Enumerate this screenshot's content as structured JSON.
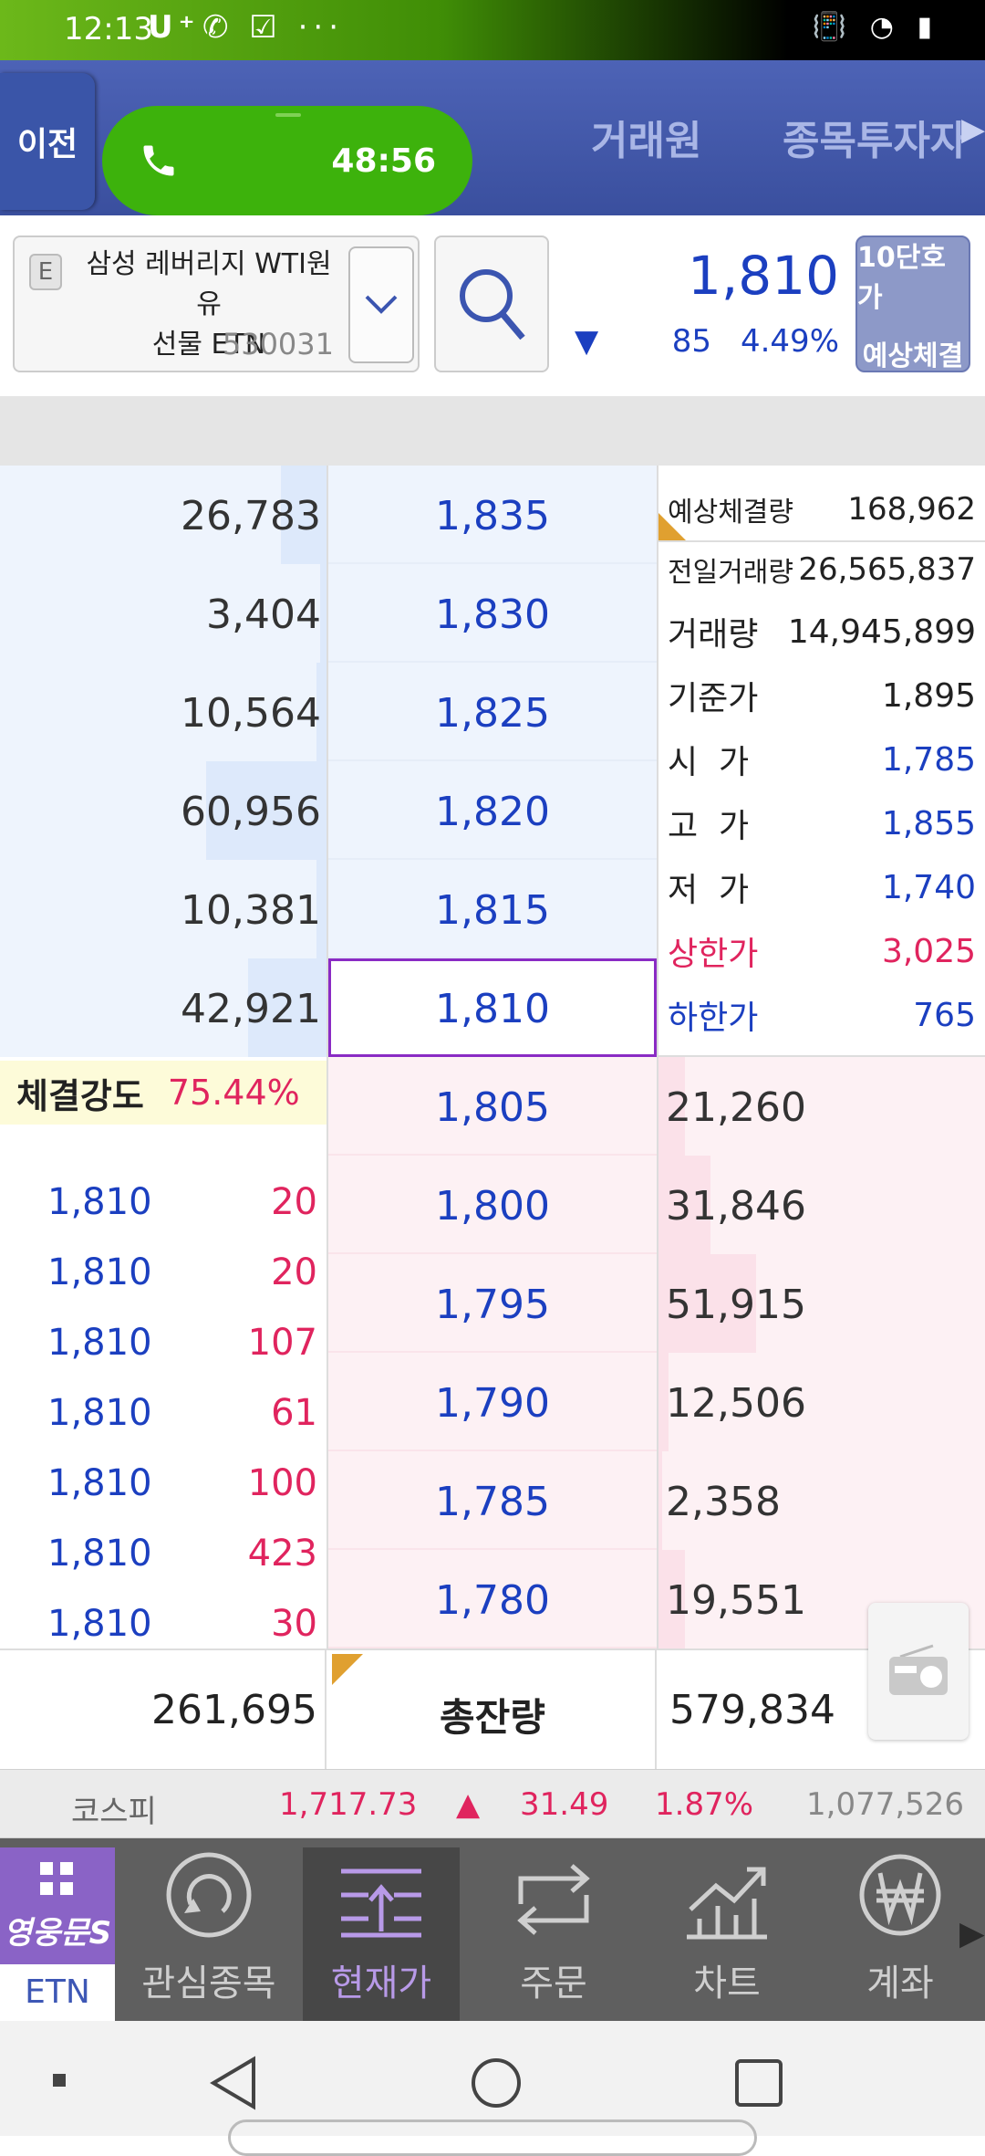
{
  "status": {
    "time": "12:13",
    "carrier": "U⁺",
    "left_icons": "✆ ☑ ···",
    "right_icons": "📳 ◔ ▮"
  },
  "header": {
    "back": "이전",
    "tabs": [
      "거래원",
      "종목투자자"
    ],
    "call_timer": "48:56",
    "tab_more": "▶"
  },
  "stock": {
    "badge": "E",
    "name_line1": "삼성 레버리지 WTI원유",
    "name_line2": "선물 ETN",
    "code": "530031",
    "price": "1,810",
    "direction": "▼",
    "change": "85",
    "change_pct": "4.49%",
    "hoga_btn_top": "10단호가",
    "hoga_btn_bottom": "예상체결"
  },
  "asks": [
    {
      "vol": "26,783",
      "price": "1,835",
      "bar": 0.14
    },
    {
      "vol": "3,404",
      "price": "1,830",
      "bar": 0.02
    },
    {
      "vol": "10,564",
      "price": "1,825",
      "bar": 0.03
    },
    {
      "vol": "60,956",
      "price": "1,820",
      "bar": 0.37
    },
    {
      "vol": "10,381",
      "price": "1,815",
      "bar": 0.03
    },
    {
      "vol": "42,921",
      "price": "1,810",
      "bar": 0.24
    }
  ],
  "bids": [
    {
      "vol": "21,260",
      "price": "1,805",
      "bar": 0.08
    },
    {
      "vol": "31,846",
      "price": "1,800",
      "bar": 0.16
    },
    {
      "vol": "51,915",
      "price": "1,795",
      "bar": 0.3
    },
    {
      "vol": "12,506",
      "price": "1,790",
      "bar": 0.03
    },
    {
      "vol": "2,358",
      "price": "1,785",
      "bar": 0.01
    },
    {
      "vol": "19,551",
      "price": "1,780",
      "bar": 0.08
    }
  ],
  "info": [
    {
      "label": "예상체결량",
      "value": "168,962",
      "color": "#222"
    },
    {
      "label": "전일거래량",
      "value": "26,565,837",
      "color": "#222"
    },
    {
      "label": "거래량",
      "value": "14,945,899",
      "color": "#222"
    },
    {
      "label": "기준가",
      "value": "1,895",
      "color": "#222"
    },
    {
      "label": "시  가",
      "value": "1,785",
      "color": "#1b3fc0"
    },
    {
      "label": "고  가",
      "value": "1,855",
      "color": "#1b3fc0"
    },
    {
      "label": "저  가",
      "value": "1,740",
      "color": "#1b3fc0"
    },
    {
      "label": "상한가",
      "value": "3,025",
      "color": "#e0245e"
    },
    {
      "label": "하한가",
      "value": "765",
      "color": "#1b3fc0"
    }
  ],
  "strength": {
    "label": "체결강도",
    "value": "75.44%"
  },
  "trades": [
    {
      "price": "1,810",
      "qty": "20"
    },
    {
      "price": "1,810",
      "qty": "20"
    },
    {
      "price": "1,810",
      "qty": "107"
    },
    {
      "price": "1,810",
      "qty": "61"
    },
    {
      "price": "1,810",
      "qty": "100"
    },
    {
      "price": "1,810",
      "qty": "423"
    },
    {
      "price": "1,810",
      "qty": "30"
    }
  ],
  "totals": {
    "ask_total": "261,695",
    "label": "총잔량",
    "bid_total": "579,834"
  },
  "index": {
    "name": "코스피",
    "value": "1,717.73",
    "arrow": "▲",
    "change": "31.49",
    "pct": "1.87%",
    "volume": "1,077,526"
  },
  "nav": {
    "brand": "영웅문S",
    "brand_sub": "ETN",
    "items": [
      "관심종목",
      "현재가",
      "주문",
      "차트",
      "계좌"
    ],
    "more": "▶"
  }
}
